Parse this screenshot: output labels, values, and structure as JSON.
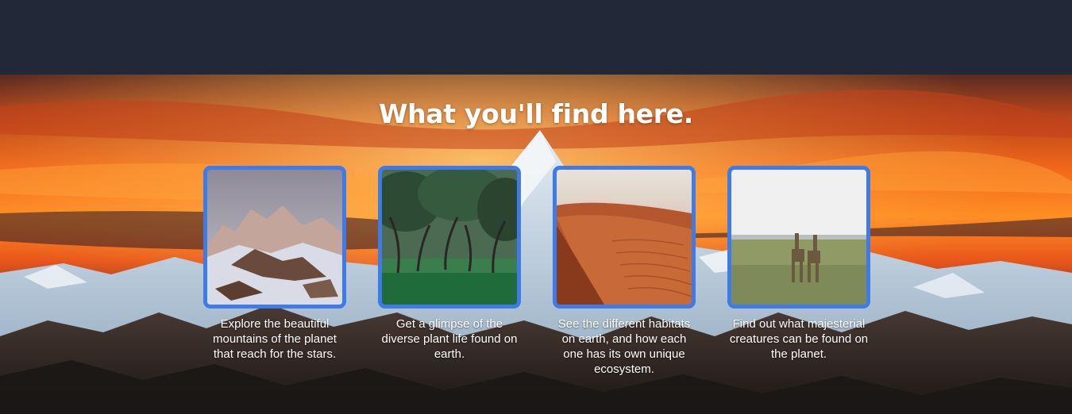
{
  "hero": {
    "title": "What you'll find here.",
    "background": "mountain-sunset-image"
  },
  "cards": [
    {
      "image": "snowy-mountains-image",
      "text": "Explore the beautiful mountains of the planet that reach for the stars."
    },
    {
      "image": "forest-trees-image",
      "text": "Get a glimpse of the diverse plant life found on earth."
    },
    {
      "image": "desert-dunes-image",
      "text": "See the different habitats on earth, and how each one has its own unique ecosystem."
    },
    {
      "image": "giraffes-savanna-image",
      "text": "Find out what majesterial creatures can be found on the planet."
    }
  ],
  "colors": {
    "header": "#222837",
    "card_border": "#3d7be8",
    "text": "#ffffff"
  }
}
